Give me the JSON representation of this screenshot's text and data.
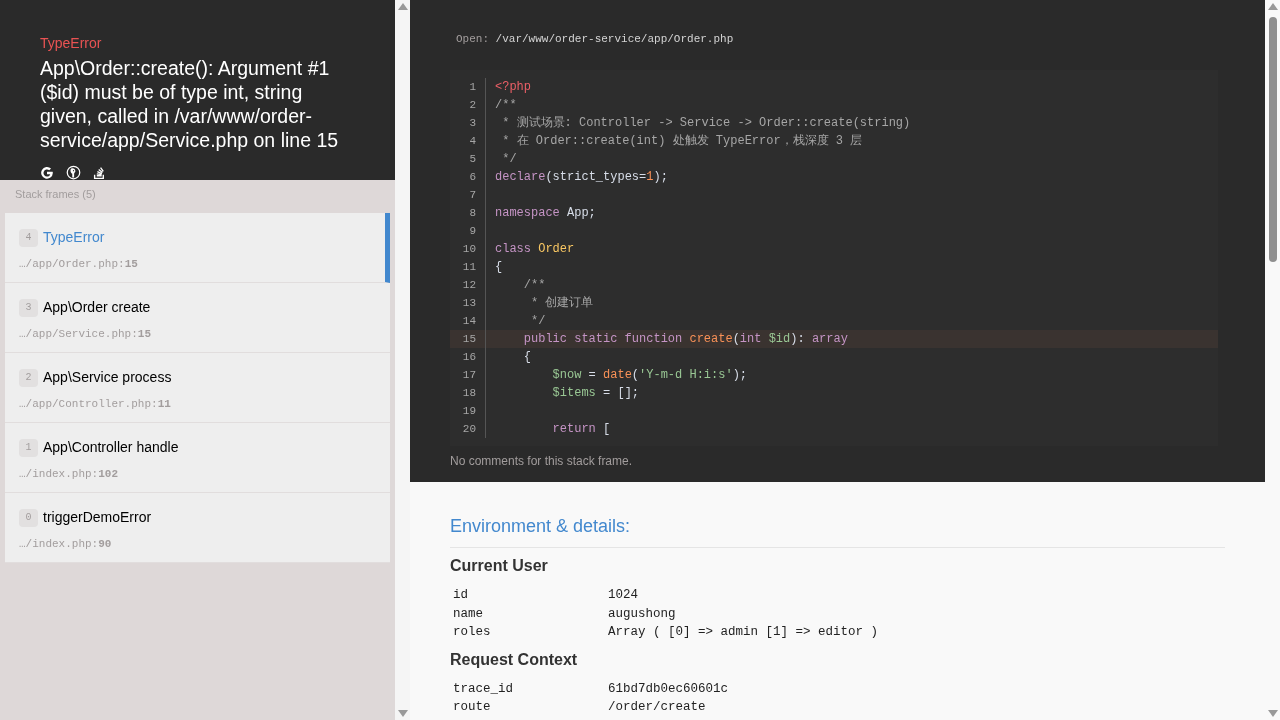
{
  "error": {
    "type": "TypeError",
    "message": "App\\Order::create(): Argument #1 ($id) must be of type int, string given, called in /var/www/order-service/app/Service.php on line 15"
  },
  "stack_title": "Stack frames (5)",
  "frames": [
    {
      "index": "4",
      "title": "TypeError",
      "file": "…/app/Order.php:**15**",
      "selected": true
    },
    {
      "index": "3",
      "title": "App\\Order create",
      "file": "…/app/Service.php:**15**",
      "selected": false
    },
    {
      "index": "2",
      "title": "App\\Service process",
      "file": "…/app/Controller.php:**11**",
      "selected": false
    },
    {
      "index": "1",
      "title": "App\\Controller handle",
      "file": "…/index.php:**102**",
      "selected": false
    },
    {
      "index": "0",
      "title": "triggerDemoError",
      "file": "…/index.php:**90**",
      "selected": false
    }
  ],
  "open_label": "Open:",
  "open_path": "/var/www/order-service/app/Order.php",
  "code_lines": [
    {
      "number": "1",
      "highlighted": false,
      "tokens": [
        {
          "kind": "tag",
          "text": "<?php"
        }
      ]
    },
    {
      "number": "2",
      "highlighted": false,
      "tokens": [
        {
          "kind": "comment",
          "text": "/**"
        }
      ]
    },
    {
      "number": "3",
      "highlighted": false,
      "tokens": [
        {
          "kind": "comment",
          "text": " * 测试场景: Controller -> Service -> Order::create(string)"
        }
      ]
    },
    {
      "number": "4",
      "highlighted": false,
      "tokens": [
        {
          "kind": "comment",
          "text": " * 在 Order::create(int) 处触发 TypeError，栈深度 3 层"
        }
      ]
    },
    {
      "number": "5",
      "highlighted": false,
      "tokens": [
        {
          "kind": "comment",
          "text": " */"
        }
      ]
    },
    {
      "number": "6",
      "highlighted": false,
      "tokens": [
        {
          "kind": "keyword",
          "text": "declare"
        },
        {
          "kind": "plain",
          "text": "(strict_types="
        },
        {
          "kind": "number",
          "text": "1"
        },
        {
          "kind": "plain",
          "text": ");"
        }
      ]
    },
    {
      "number": "7",
      "highlighted": false
    },
    {
      "number": "8",
      "highlighted": false,
      "tokens": [
        {
          "kind": "keyword",
          "text": "namespace"
        },
        {
          "kind": "plain",
          "text": " App;"
        }
      ]
    },
    {
      "number": "9",
      "highlighted": false
    },
    {
      "number": "10",
      "highlighted": false,
      "tokens": [
        {
          "kind": "keyword",
          "text": "class "
        },
        {
          "kind": "class",
          "text": "Order"
        }
      ]
    },
    {
      "number": "11",
      "highlighted": false,
      "tokens": [
        {
          "kind": "plain",
          "text": "{"
        }
      ]
    },
    {
      "number": "12",
      "highlighted": false,
      "tokens": [
        {
          "kind": "comment",
          "text": "    /**"
        }
      ]
    },
    {
      "number": "13",
      "highlighted": false,
      "tokens": [
        {
          "kind": "comment",
          "text": "     * 创建订单"
        }
      ]
    },
    {
      "number": "14",
      "highlighted": false,
      "tokens": [
        {
          "kind": "comment",
          "text": "     */"
        }
      ]
    },
    {
      "number": "15",
      "highlighted": true,
      "tokens": [
        {
          "kind": "keyword",
          "text": "    public static function "
        },
        {
          "kind": "function",
          "text": "create"
        },
        {
          "kind": "plain",
          "text": "("
        },
        {
          "kind": "keyword",
          "text": "int "
        },
        {
          "kind": "variable",
          "text": "$id"
        },
        {
          "kind": "plain",
          "text": "): "
        },
        {
          "kind": "keyword",
          "text": "array"
        }
      ]
    },
    {
      "number": "16",
      "highlighted": false,
      "tokens": [
        {
          "kind": "plain",
          "text": "    {"
        }
      ]
    },
    {
      "number": "17",
      "highlighted": false,
      "tokens": [
        {
          "kind": "variable",
          "text": "        $now"
        },
        {
          "kind": "plain",
          "text": " = "
        },
        {
          "kind": "function",
          "text": "date"
        },
        {
          "kind": "plain",
          "text": "("
        },
        {
          "kind": "string",
          "text": "'Y-m-d H:i:s'"
        },
        {
          "kind": "plain",
          "text": ");"
        }
      ]
    },
    {
      "number": "18",
      "highlighted": false,
      "tokens": [
        {
          "kind": "variable",
          "text": "        $items"
        },
        {
          "kind": "plain",
          "text": " = [];"
        }
      ]
    },
    {
      "number": "19",
      "highlighted": false
    },
    {
      "number": "20",
      "highlighted": false,
      "tokens": [
        {
          "kind": "keyword",
          "text": "        return"
        },
        {
          "kind": "plain",
          "text": " ["
        }
      ]
    }
  ],
  "frame_comments": "No comments for this stack frame.",
  "details_title": "Environment & details:",
  "sections": [
    {
      "title": "Current User",
      "rows": [
        {
          "key": "id",
          "value": "1024"
        },
        {
          "key": "name",
          "value": "augushong"
        },
        {
          "key": "roles",
          "value": "Array ( [0] => admin [1] => editor )"
        }
      ]
    },
    {
      "title": "Request Context",
      "rows": [
        {
          "key": "trace_id",
          "value": "61bd7db0ec60601c"
        },
        {
          "key": "route",
          "value": "/order/create"
        }
      ]
    }
  ]
}
